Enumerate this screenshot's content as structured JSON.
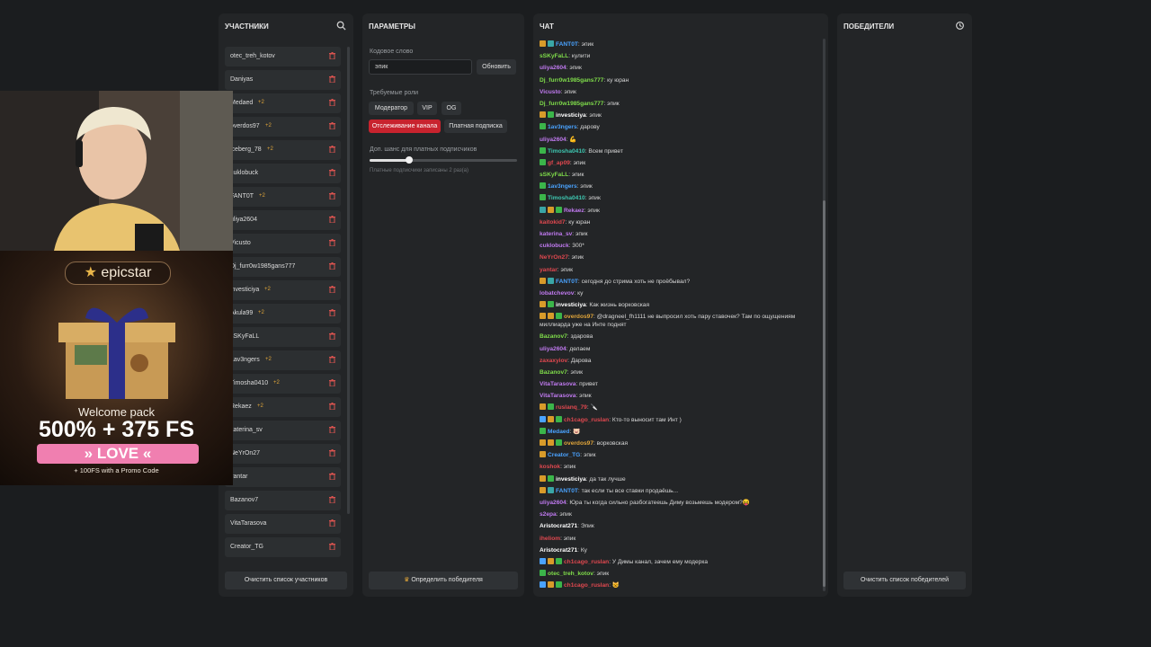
{
  "colors": {
    "accent_red": "#c8232e",
    "badge_gold": "#e0a53a",
    "panel": "#232527",
    "bg": "#1b1d1f"
  },
  "participants": {
    "title": "УЧАСТНИКИ",
    "search_icon": "search-icon",
    "clear_label": "Очистить список участников",
    "items": [
      {
        "name": "otec_treh_kotov",
        "badge": ""
      },
      {
        "name": "Daniyas",
        "badge": ""
      },
      {
        "name": "Medaed",
        "badge": "+2"
      },
      {
        "name": "overdos97",
        "badge": "+2"
      },
      {
        "name": "iceberg_78",
        "badge": "+2"
      },
      {
        "name": "cuklobuck",
        "badge": ""
      },
      {
        "name": "FANT0T",
        "badge": "+2"
      },
      {
        "name": "uliya2604",
        "badge": ""
      },
      {
        "name": "Vicusto",
        "badge": ""
      },
      {
        "name": "Dj_furr0w1985gans777",
        "badge": ""
      },
      {
        "name": "investiciya",
        "badge": "+2"
      },
      {
        "name": "Akula99",
        "badge": "+2"
      },
      {
        "name": "sSKyFaLL",
        "badge": ""
      },
      {
        "name": "1av3ngers",
        "badge": "+2"
      },
      {
        "name": "Timosha0410",
        "badge": "+2"
      },
      {
        "name": "Rekaez",
        "badge": "+2"
      },
      {
        "name": "katerina_sv",
        "badge": ""
      },
      {
        "name": "NeYrOn27",
        "badge": ""
      },
      {
        "name": "yantar",
        "badge": ""
      },
      {
        "name": "Bazanov7",
        "badge": ""
      },
      {
        "name": "VitaTarasova",
        "badge": ""
      },
      {
        "name": "Creator_TG",
        "badge": ""
      }
    ]
  },
  "params": {
    "title": "ПАРАМЕТРЫ",
    "keyword_label": "Кодовое слово",
    "keyword_value": "эпик",
    "update_label": "Обновить",
    "roles_label": "Требуемые роли",
    "roles": [
      "Модератор",
      "VIP",
      "OG"
    ],
    "role_tracking": "Отслеживание канала",
    "role_paid": "Платная подписка",
    "chance_label": "Доп. шанс для платных подписчиков",
    "chance_value": 0.27,
    "chance_note": "Платные подписчики записаны 2 раз(а)",
    "pick_winner_label": "Определить победителя"
  },
  "chat": {
    "title": "ЧАТ",
    "lines": [
      {
        "user": "FANT0T",
        "color": "#4aa3ff",
        "badges": [
          "#d89b2a",
          "#3aa6a6"
        ],
        "text": "эпик"
      },
      {
        "user": "sSKyFaLL",
        "color": "#7fdc4a",
        "badges": [],
        "text": "кулити"
      },
      {
        "user": "uliya2604",
        "color": "#c07af0",
        "badges": [],
        "text": "эпик"
      },
      {
        "user": "Dj_furr0w1985gans777",
        "color": "#7fdc4a",
        "badges": [],
        "text": "ку юран"
      },
      {
        "user": "Vicusto",
        "color": "#c07af0",
        "badges": [],
        "text": "эпик"
      },
      {
        "user": "Dj_furr0w1985gans777",
        "color": "#7fdc4a",
        "badges": [],
        "text": "эпик"
      },
      {
        "user": "investiciya",
        "color": "#ffffff",
        "badges": [
          "#d89b2a",
          "#3bb54a"
        ],
        "text": "эпик"
      },
      {
        "user": "1av3ngers",
        "color": "#4aa3ff",
        "badges": [
          "#3bb54a"
        ],
        "text": "дарову"
      },
      {
        "user": "uliya2604",
        "color": "#c07af0",
        "badges": [],
        "text": "💪"
      },
      {
        "user": "Timosha0410",
        "color": "#3ec6b0",
        "badges": [
          "#3bb54a"
        ],
        "text": "Всем привет"
      },
      {
        "user": "gf_ap09",
        "color": "#e0484f",
        "badges": [
          "#3bb54a"
        ],
        "text": "эпик"
      },
      {
        "user": "sSKyFaLL",
        "color": "#7fdc4a",
        "badges": [],
        "text": "эпик"
      },
      {
        "user": "1av3ngers",
        "color": "#4aa3ff",
        "badges": [
          "#3bb54a"
        ],
        "text": "эпик"
      },
      {
        "user": "Timosha0410",
        "color": "#3ec6b0",
        "badges": [
          "#3bb54a"
        ],
        "text": "эпик"
      },
      {
        "user": "Rekaez",
        "color": "#c07af0",
        "badges": [
          "#3aa6a6",
          "#d89b2a",
          "#3bb54a"
        ],
        "text": "эпик"
      },
      {
        "user": "kaitokid7",
        "color": "#e0484f",
        "badges": [],
        "text": "ку юран"
      },
      {
        "user": "katerina_sv",
        "color": "#c07af0",
        "badges": [],
        "text": "эпик"
      },
      {
        "user": "cuklobuck",
        "color": "#c07af0",
        "badges": [],
        "text": "300*"
      },
      {
        "user": "NeYrOn27",
        "color": "#e0484f",
        "badges": [],
        "text": "эпик"
      },
      {
        "user": "yantar",
        "color": "#e0484f",
        "badges": [],
        "text": "эпик"
      },
      {
        "user": "FANT0T",
        "color": "#4aa3ff",
        "badges": [
          "#d89b2a",
          "#3aa6a6"
        ],
        "text": "сегодня до стрима хоть не проёбывал?"
      },
      {
        "user": "lobatchevov",
        "color": "#c07af0",
        "badges": [],
        "text": "ку"
      },
      {
        "user": "investiciya",
        "color": "#ffffff",
        "badges": [
          "#d89b2a",
          "#3bb54a"
        ],
        "text": "Как жизнь ворковская"
      },
      {
        "user": "overdos97",
        "color": "#e0a53a",
        "badges": [
          "#d89b2a",
          "#d89b2a",
          "#3bb54a"
        ],
        "text": "@dragneel_fh1111 не выпросил хоть пару ставочек? Там по ощущениям миллиарда уже на Инте поднят",
        "two": true
      },
      {
        "user": "Bazanov7",
        "color": "#7fdc4a",
        "badges": [],
        "text": "здарова"
      },
      {
        "user": "uliya2604",
        "color": "#c07af0",
        "badges": [],
        "text": "делаем"
      },
      {
        "user": "zaxaxyiov",
        "color": "#e0484f",
        "badges": [],
        "text": "Дарова"
      },
      {
        "user": "Bazanov7",
        "color": "#7fdc4a",
        "badges": [],
        "text": "эпик"
      },
      {
        "user": "VitaTarasova",
        "color": "#c07af0",
        "badges": [],
        "text": "привет"
      },
      {
        "user": "VitaTarasova",
        "color": "#c07af0",
        "badges": [],
        "text": "эпик"
      },
      {
        "user": "ruslanq_79",
        "color": "#e0484f",
        "badges": [
          "#d89b2a",
          "#3bb54a"
        ],
        "text": "🔪"
      },
      {
        "user": "ch1cago_ruslan",
        "color": "#e0484f",
        "badges": [
          "#4aa3ff",
          "#d89b2a",
          "#3bb54a"
        ],
        "text": "Кто-то выносит там Инт )"
      },
      {
        "user": "Medaed",
        "color": "#4aa3ff",
        "badges": [
          "#3bb54a"
        ],
        "text": "🐷"
      },
      {
        "user": "overdos97",
        "color": "#e0a53a",
        "badges": [
          "#d89b2a",
          "#d89b2a",
          "#3bb54a"
        ],
        "text": "ворковская"
      },
      {
        "user": "Creator_TG",
        "color": "#4aa3ff",
        "badges": [
          "#d89b2a"
        ],
        "text": "эпик"
      },
      {
        "user": "koshok",
        "color": "#e0484f",
        "badges": [],
        "text": "эпик"
      },
      {
        "user": "investiciya",
        "color": "#ffffff",
        "badges": [
          "#d89b2a",
          "#3bb54a"
        ],
        "text": "да так лучше"
      },
      {
        "user": "FANT0T",
        "color": "#4aa3ff",
        "badges": [
          "#d89b2a",
          "#3aa6a6"
        ],
        "text": "так если ты все ставки продаёшь..."
      },
      {
        "user": "uliya2604",
        "color": "#c07af0",
        "badges": [],
        "text": "Юра ты когда сильно разбогатеешь Диму возьмешь модером?😝"
      },
      {
        "user": "s2epa",
        "color": "#c07af0",
        "badges": [],
        "text": "эпик"
      },
      {
        "user": "Aristocrat271",
        "color": "#ffffff",
        "badges": [],
        "text": "Эпик"
      },
      {
        "user": "iheliom",
        "color": "#e0484f",
        "badges": [],
        "text": "эпик"
      },
      {
        "user": "Aristocrat271",
        "color": "#ffffff",
        "badges": [],
        "text": "Ку"
      },
      {
        "user": "ch1cago_ruslan",
        "color": "#e0484f",
        "badges": [
          "#4aa3ff",
          "#d89b2a",
          "#3bb54a"
        ],
        "text": "У Димы канал, зачем ему модерка"
      },
      {
        "user": "otec_treh_kotov",
        "color": "#7fdc4a",
        "badges": [
          "#3bb54a"
        ],
        "text": "эпик"
      },
      {
        "user": "ch1cago_ruslan",
        "color": "#e0484f",
        "badges": [
          "#4aa3ff",
          "#d89b2a",
          "#3bb54a"
        ],
        "text": "😺"
      }
    ]
  },
  "winners": {
    "title": "ПОБЕДИТЕЛИ",
    "icon": "history-icon",
    "clear_label": "Очистить список победителей"
  },
  "ad": {
    "brand": "epicstar",
    "welcome": "Welcome pack",
    "offer": "500% + 375 FS",
    "love": "» LOVE «",
    "promo": "+ 100FS with a Promo Code"
  }
}
